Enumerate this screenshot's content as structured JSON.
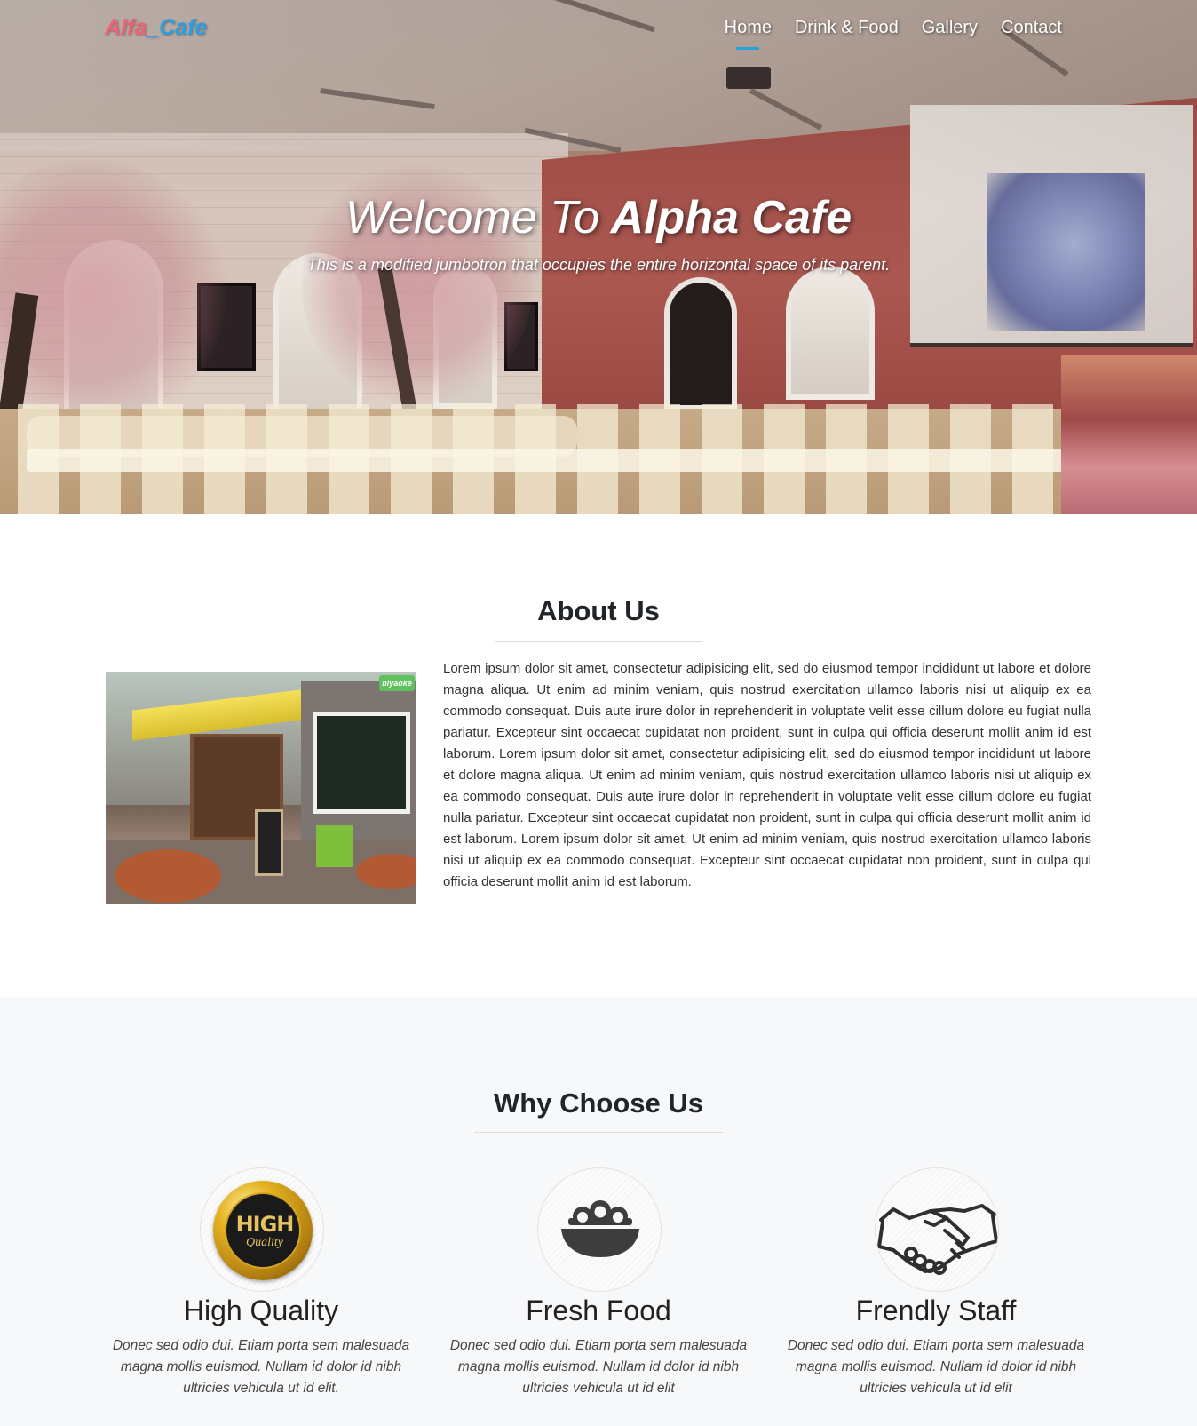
{
  "brand": {
    "part1": "Alfa",
    "part2": "_Cafe"
  },
  "nav": {
    "items": [
      {
        "label": "Home",
        "active": true
      },
      {
        "label": "Drink & Food",
        "active": false
      },
      {
        "label": "Gallery",
        "active": false
      },
      {
        "label": "Contact",
        "active": false
      }
    ]
  },
  "hero": {
    "title_lead": "Welcome To",
    "title_strong": "Alpha Cafe",
    "subtitle": "This is a modified jumbotron that occupies the entire horizontal space of its parent."
  },
  "about": {
    "title": "About Us",
    "photo_badge": "niyaoke",
    "text": "Lorem ipsum dolor sit amet, consectetur adipisicing elit, sed do eiusmod tempor incididunt ut labore et dolore magna aliqua. Ut enim ad minim veniam, quis nostrud exercitation ullamco laboris nisi ut aliquip ex ea commodo consequat. Duis aute irure dolor in reprehenderit in voluptate velit esse cillum dolore eu fugiat nulla pariatur. Excepteur sint occaecat cupidatat non proident, sunt in culpa qui officia deserunt mollit anim id est laborum. Lorem ipsum dolor sit amet, consectetur adipisicing elit, sed do eiusmod tempor incididunt ut labore et dolore magna aliqua. Ut enim ad minim veniam, quis nostrud exercitation ullamco laboris nisi ut aliquip ex ea commodo consequat. Duis aute irure dolor in reprehenderit in voluptate velit esse cillum dolore eu fugiat nulla pariatur. Excepteur sint occaecat cupidatat non proident, sunt in culpa qui officia deserunt mollit anim id est laborum. Lorem ipsum dolor sit amet, Ut enim ad minim veniam, quis nostrud exercitation ullamco laboris nisi ut aliquip ex ea commodo consequat. Excepteur sint occaecat cupidatat non proident, sunt in culpa qui officia deserunt mollit anim id est laborum."
  },
  "why": {
    "title": "Why Choose Us",
    "features": [
      {
        "icon": "high-quality-badge-icon",
        "badge_text": "HIGH",
        "badge_script": "Quality",
        "title": "High Quality",
        "text": "Donec sed odio dui. Etiam porta sem malesuada magna mollis euismod. Nullam id dolor id nibh ultricies vehicula ut id elit."
      },
      {
        "icon": "food-bowl-icon",
        "title": "Fresh Food",
        "text": "Donec sed odio dui. Etiam porta sem malesuada magna mollis euismod. Nullam id dolor id nibh ultricies vehicula ut id elit"
      },
      {
        "icon": "handshake-icon",
        "title": "Frendly Staff",
        "text": "Donec sed odio dui. Etiam porta sem malesuada magna mollis euismod. Nullam id dolor id nibh ultricies vehicula ut id elit"
      }
    ]
  },
  "colors": {
    "brand_part1": "#f06277",
    "brand_part2": "#2d9ee0",
    "nav_active_underline": "#21a3e0",
    "section_bg": "#f7f8f9"
  }
}
